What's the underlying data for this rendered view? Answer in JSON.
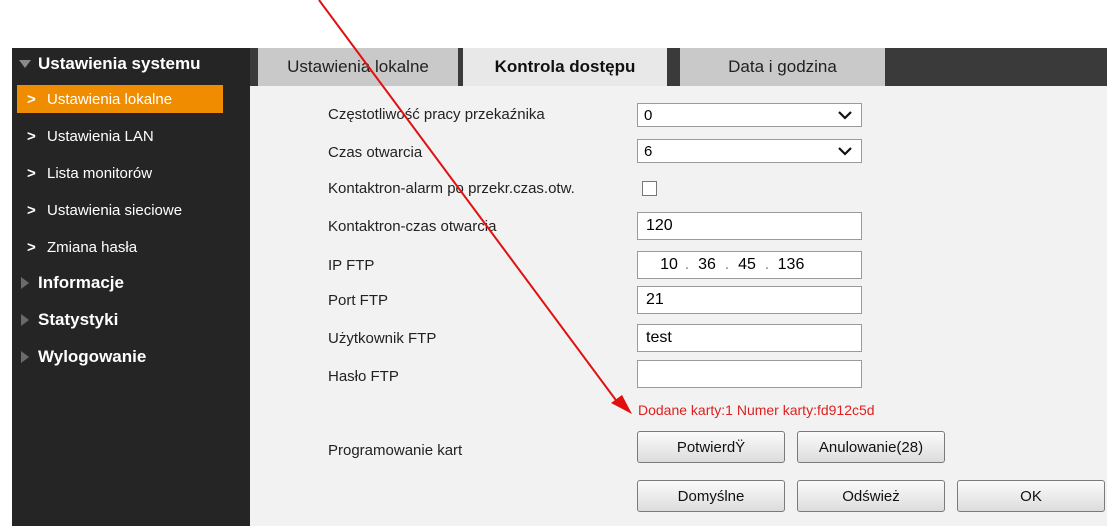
{
  "sidebar": {
    "section_system": "Ustawienia systemu",
    "items": [
      {
        "label": "Ustawienia lokalne"
      },
      {
        "label": "Ustawienia LAN"
      },
      {
        "label": "Lista monitorów"
      },
      {
        "label": "Ustawienia sieciowe"
      },
      {
        "label": "Zmiana hasła"
      }
    ],
    "chevron": ">",
    "section_info": "Informacje",
    "section_stats": "Statystyki",
    "section_logout": "Wylogowanie"
  },
  "tabs": [
    {
      "label": "Ustawienia lokalne"
    },
    {
      "label": "Kontrola dostępu"
    },
    {
      "label": "Data i godzina"
    }
  ],
  "form": {
    "relay_freq_label": "Częstotliwość pracy przekaźnika",
    "relay_freq_value": "0",
    "open_time_label": "Czas otwarcia",
    "open_time_value": "6",
    "contact_alarm_label": "Kontaktron-alarm po przekr.czas.otw.",
    "contact_open_label": "Kontaktron-czas otwarcia",
    "contact_open_value": "120",
    "ftp_ip_label": "IP FTP",
    "ftp_ip": [
      "10",
      "36",
      "45",
      "136"
    ],
    "ip_separator": ".",
    "ftp_port_label": "Port FTP",
    "ftp_port_value": "21",
    "ftp_user_label": "Użytkownik FTP",
    "ftp_user_value": "test",
    "ftp_pass_label": "Hasło FTP",
    "ftp_pass_value": "",
    "card_message": "Dodane karty:1 Numer karty:fd912c5d",
    "card_prog_label": "Programowanie kart"
  },
  "buttons": {
    "confirm": "PotwierdŸ",
    "cancel": "Anulowanie(28)",
    "default": "Domyślne",
    "refresh": "Odśwież",
    "ok": "OK"
  },
  "colors": {
    "accent": "#f08c00",
    "message": "#e02020",
    "annotation_arrow": "#e01010"
  }
}
